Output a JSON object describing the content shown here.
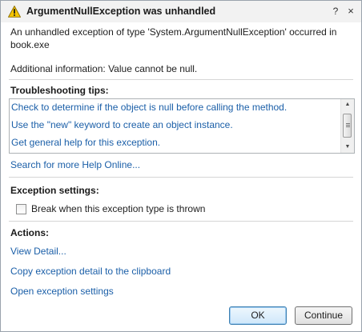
{
  "title_bar": {
    "title": "ArgumentNullException was unhandled",
    "icon": "warning-icon",
    "help_label": "?",
    "close_label": "×"
  },
  "message": {
    "text": "An unhandled exception of type 'System.ArgumentNullException' occurred in book.exe",
    "additional": "Additional information: Value cannot be null."
  },
  "troubleshooting": {
    "heading": "Troubleshooting tips:",
    "tips": [
      "Check to determine if the object is null before calling the method.",
      "Use the \"new\" keyword to create an object instance.",
      "Get general help for this exception."
    ],
    "search_link": "Search for more Help Online..."
  },
  "exception_settings": {
    "heading": "Exception settings:",
    "break_label": "Break when this exception type is thrown",
    "break_checked": false
  },
  "actions": {
    "heading": "Actions:",
    "links": [
      "View Detail...",
      "Copy exception detail to the clipboard",
      "Open exception settings"
    ]
  },
  "buttons": {
    "ok": "OK",
    "continue": "Continue"
  },
  "colors": {
    "link": "#1b5fa8",
    "warning": "#f5c400"
  }
}
